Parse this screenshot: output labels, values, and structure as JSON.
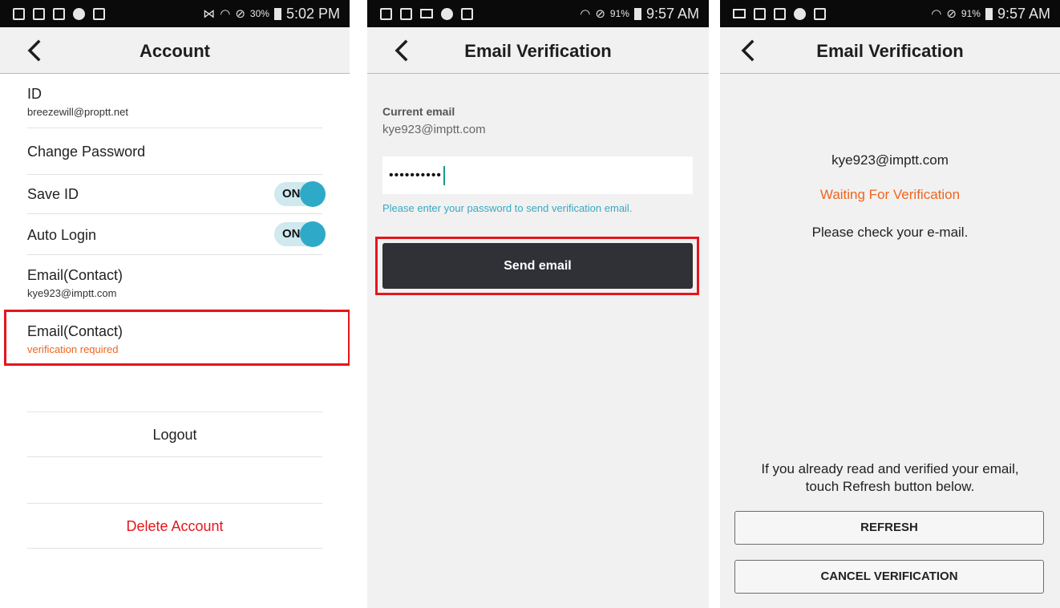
{
  "screens": [
    {
      "status": {
        "battery_pct": "30%",
        "time": "5:02 PM"
      },
      "title": "Account",
      "rows": {
        "id": {
          "title": "ID",
          "value": "breezewill@proptt.net"
        },
        "change_password": {
          "title": "Change Password"
        },
        "save_id": {
          "title": "Save ID",
          "toggle": "ON"
        },
        "auto_login": {
          "title": "Auto Login",
          "toggle": "ON"
        },
        "email_contact": {
          "title": "Email(Contact)",
          "value": "kye923@imptt.com"
        },
        "email_contact_2": {
          "title": "Email(Contact)",
          "value": "verification required"
        }
      },
      "logout": "Logout",
      "delete_account": "Delete Account"
    },
    {
      "status": {
        "battery_pct": "91%",
        "time": "9:57 AM"
      },
      "title": "Email Verification",
      "current_email_label": "Current email",
      "current_email": "kye923@imptt.com",
      "password_value": "••••••••••",
      "hint": "Please enter your password to send verification email.",
      "send_button": "Send email"
    },
    {
      "status": {
        "battery_pct": "91%",
        "time": "9:57 AM"
      },
      "title": "Email Verification",
      "email": "kye923@imptt.com",
      "status_text": "Waiting For Verification",
      "instruction": "Please check your e-mail.",
      "refresh_note_line1": "If you already read and verified your email,",
      "refresh_note_line2": "touch Refresh button below.",
      "refresh_button": "REFRESH",
      "cancel_button": "CANCEL VERIFICATION"
    }
  ],
  "colors": {
    "accent_orange": "#f0651e",
    "highlight_red": "#e5161c",
    "toggle_blue": "#2eaac8",
    "hint_blue": "#38a9c1"
  }
}
